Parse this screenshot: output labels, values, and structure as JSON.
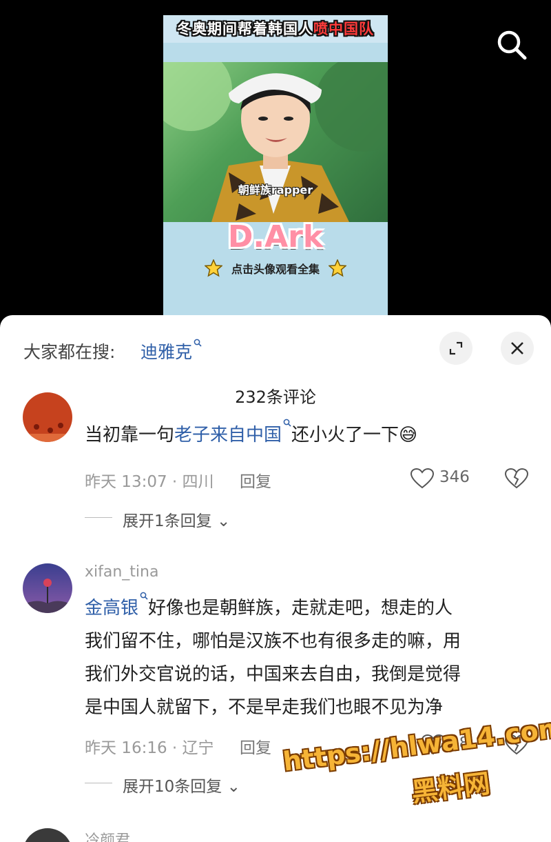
{
  "video": {
    "banner": "冬奥期间帮着韩国人",
    "banner_highlight": "喷中国队",
    "caption": "朝鲜族rapper",
    "title": "D.Ark",
    "hint": "点击头像观看全集"
  },
  "sheet": {
    "trend_label": "大家都在搜:",
    "trend_keyword": "迪雅克",
    "comment_count": "232条评论"
  },
  "comments": [
    {
      "text_before": "当初靠一句",
      "keyword": "老子来自中国",
      "text_after": "还小火了一下",
      "emoji": "😅",
      "meta": "昨天 13:07 · 四川",
      "reply_label": "回复",
      "likes": "346",
      "expand": "展开1条回复"
    },
    {
      "username": "xifan_tina",
      "keyword": "金高银",
      "line1": "好像也是朝鲜族，走就走吧，想走的人",
      "line2": "我们留不住，哪怕是汉族不也有很多走的嘛，用",
      "line3": "我们外交官说的话，中国来去自由，我倒是觉得",
      "line4": "是中国人就留下，不是早走我们也眼不见为净",
      "meta": "昨天 16:16 · 辽宁",
      "reply_label": "回复",
      "likes": "98",
      "expand": "展开10条回复"
    },
    {
      "username": "冷颜君"
    }
  ],
  "watermark": {
    "url": "https://hlwa14.com",
    "name": "黑料网"
  },
  "icons": {
    "search": "search-icon",
    "expand": "expand-icon",
    "close": "close-icon",
    "like": "heart-icon",
    "dislike": "broken-heart-icon"
  }
}
